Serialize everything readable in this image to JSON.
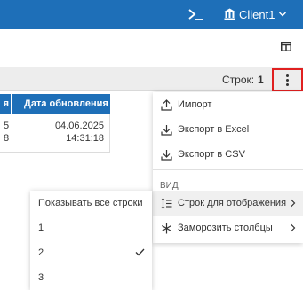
{
  "header": {
    "terminal_icon": "terminal-icon",
    "account_icon": "bank-icon",
    "client_label": "Client1",
    "accent": "#1e6fb8"
  },
  "page": {
    "layout_icon": "columns-layout-icon"
  },
  "toolbar": {
    "rows_label": "Строк:",
    "rows_value": "1",
    "more_icon": "more-vertical-icon",
    "highlight_color": "#e02020"
  },
  "table": {
    "col1_header": "я",
    "col2_header": "Дата обновления",
    "row": {
      "col1_line1": "5",
      "col1_line2": "8",
      "date": "04.06.2025",
      "time": "14:31:18"
    }
  },
  "menu": {
    "items": [
      {
        "label": "Импорт",
        "icon": "upload-icon"
      },
      {
        "label": "Экспорт в Excel",
        "icon": "download-icon"
      },
      {
        "label": "Экспорт в CSV",
        "icon": "download-icon"
      }
    ],
    "section_label": "ВИД",
    "view_items": [
      {
        "label": "Строк для отображения",
        "icon": "row-height-icon"
      },
      {
        "label": "Заморозить столбцы",
        "icon": "snowflake-icon"
      }
    ]
  },
  "submenu": {
    "items": [
      "Показывать все строки",
      "1",
      "2",
      "3"
    ],
    "selected": "2"
  }
}
